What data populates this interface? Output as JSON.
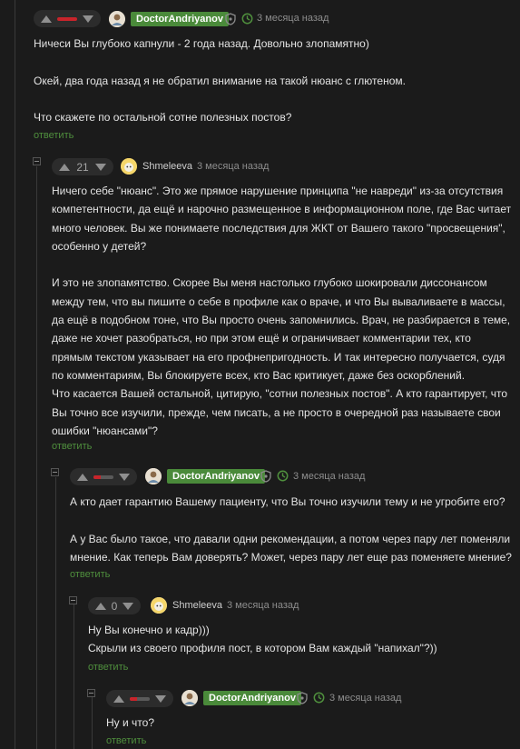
{
  "comments": [
    {
      "author": "DoctorAndriyanov",
      "author_style": "badge",
      "time": "3 месяца назад",
      "rating": "",
      "rating_bar": "negative",
      "text": "Ничеси Вы глубоко капнули - 2 года назад. Довольно злопамятно)\n\nОкей, два года назад я не обратил внимание на такой нюанс с глютеном.\n\nЧто скажете по остальной сотне полезных постов?",
      "reply": "ответить"
    },
    {
      "author": "Shmeleeva",
      "author_style": "plain",
      "time": "3 месяца назад",
      "rating": "21",
      "text": "Ничего себе \"нюанс\". Это же прямое нарушение принципа \"не навреди\" из-за отсутствия\nкомпетентности, да ещё и нарочно размещенное в информационном поле, где Вас читает\nмного человек. Вы же понимаете последствия для ЖКТ от Вашего такого \"просвещения\",\nособенно у детей?\n\nИ это не злопамятство. Скорее Вы меня настолько глубоко шокировали диссонансом\nмежду тем, что вы пишите о себе в профиле как о враче, и что Вы вываливаете в массы,\nда ещё в подобном тоне, что Вы просто очень запомнились. Врач, не разбирается в теме,\nдаже не хочет разобраться, но при этом ещё и ограничивает комментарии тех, кто\nпрямым текстом указывает на его профнепригодность. И так интересно получается, судя\nпо комментариям, Вы блокируете всех, кто Вас критикует, даже без оскорблений.\nЧто касается Вашей остальной, цитирую, \"сотни полезных постов\". А кто гарантирует, что\nВы точно все изучили, прежде, чем писать, а не просто в очередной раз называете свои\nошибки \"нюансами\"?",
      "reply": "ответить"
    },
    {
      "author": "DoctorAndriyanov",
      "author_style": "badge",
      "time": "3 месяца назад",
      "rating": "",
      "rating_bar": "mixed",
      "rating_fraction": 0.35,
      "text": "А кто дает гарантию Вашему пациенту, что Вы точно изучили тему и не угробите его?\n\nА у Вас было такое, что давали одни рекомендации, а потом через пару лет поменяли\nмнение. Как теперь Вам доверять? Может, через пару лет еще раз поменяете мнение?",
      "reply": "ответить"
    },
    {
      "author": "Shmeleeva",
      "author_style": "plain",
      "time": "3 месяца назад",
      "rating": "0",
      "text": "Ну Вы конечно и кадр)))\nСкрыли из своего профиля пост, в котором Вам каждый \"напихал\"?))",
      "reply": "ответить"
    },
    {
      "author": "DoctorAndriyanov",
      "author_style": "badge",
      "time": "3 месяца назад",
      "rating": "",
      "rating_bar": "mixed",
      "rating_fraction": 0.35,
      "text": "Ну и что?",
      "reply": "ответить"
    }
  ],
  "colors": {
    "background": "#1b1b1b",
    "author_badge": "#4a8a3a",
    "reply_link": "#4f8f3d",
    "negative": "#c8242b"
  },
  "icons": [
    "chevron-up-icon",
    "chevron-down-icon",
    "avatar",
    "shield-icon",
    "refresh-icon",
    "collapse-icon"
  ]
}
